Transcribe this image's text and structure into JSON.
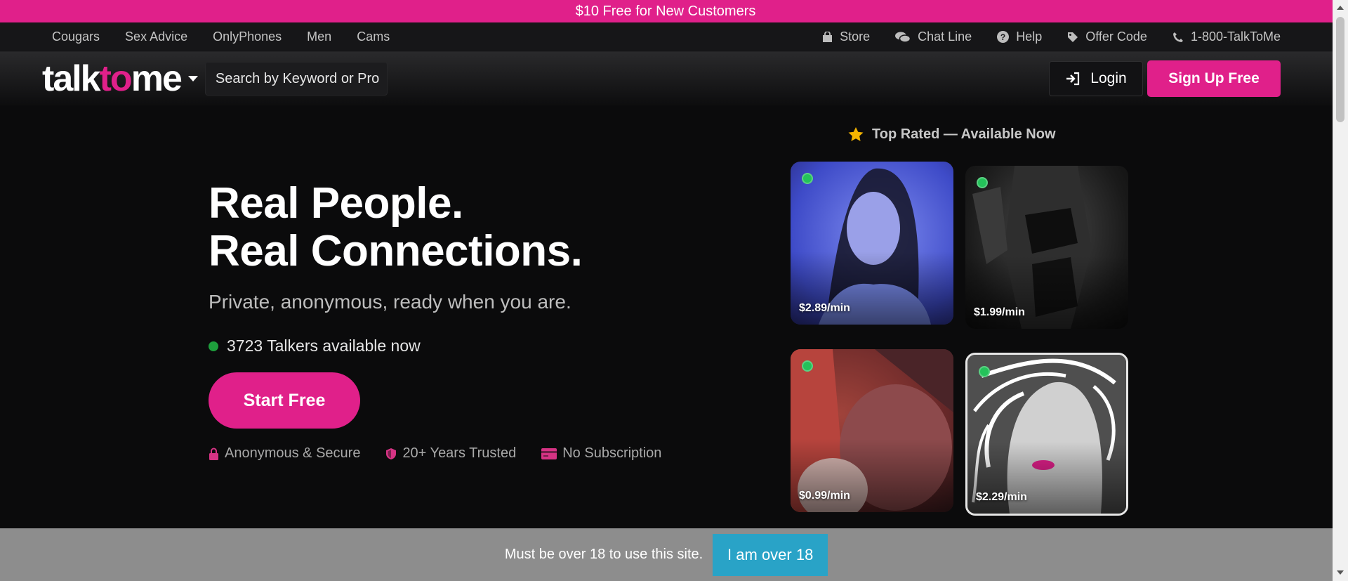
{
  "promo": {
    "text": "$10 Free for New Customers"
  },
  "utility_nav": {
    "left": [
      "Cougars",
      "Sex Advice",
      "OnlyPhones",
      "Men",
      "Cams"
    ],
    "right": [
      {
        "label": "Store",
        "icon": "shopping-bag-icon"
      },
      {
        "label": "Chat Line",
        "icon": "chat-bubbles-icon"
      },
      {
        "label": "Help",
        "icon": "question-circle-icon"
      },
      {
        "label": "Offer Code",
        "icon": "tag-icon"
      },
      {
        "label": "1-800-TalkToMe",
        "icon": "phone-icon"
      }
    ]
  },
  "header": {
    "logo": {
      "part1": "talk",
      "part2": "to",
      "part3": "me"
    },
    "search_placeholder": "Search by Keyword or Pro",
    "login_label": "Login",
    "signup_label": "Sign Up Free"
  },
  "hero": {
    "headline_line1": "Real People.",
    "headline_line2": "Real Connections.",
    "subheadline": "Private, anonymous, ready when you are.",
    "availability": "3723 Talkers available now",
    "cta_label": "Start Free",
    "features": [
      {
        "label": "Anonymous & Secure",
        "icon": "lock-icon"
      },
      {
        "label": "20+ Years Trusted",
        "icon": "shield-icon"
      },
      {
        "label": "No Subscription",
        "icon": "credit-card-icon"
      }
    ]
  },
  "top_rated": {
    "title": "Top Rated — Available Now",
    "cards": [
      {
        "price": "$2.89/min"
      },
      {
        "price": "$1.99/min"
      },
      {
        "price": "$0.99/min"
      },
      {
        "price": "$2.29/min"
      }
    ]
  },
  "age_gate": {
    "text": "Must be over 18 to use this site.",
    "button_label": "I am over 18"
  },
  "colors": {
    "brand_pink": "#e0208a",
    "online_green": "#24c25a",
    "age_button_blue": "#29a3c7"
  }
}
